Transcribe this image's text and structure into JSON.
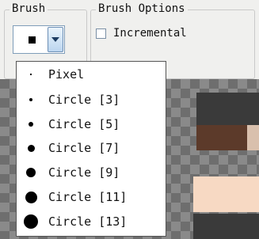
{
  "brush_group": {
    "title": "Brush",
    "selected_icon": "square-brush-icon"
  },
  "options_group": {
    "title": "Brush Options",
    "incremental_label": "Incremental",
    "incremental_checked": false
  },
  "dropdown": {
    "items": [
      {
        "label": "Pixel",
        "icon": "pixel-brush-icon"
      },
      {
        "label": "Circle [3]",
        "icon": "circle-3-icon"
      },
      {
        "label": "Circle [5]",
        "icon": "circle-5-icon"
      },
      {
        "label": "Circle [7]",
        "icon": "circle-7-icon"
      },
      {
        "label": "Circle [9]",
        "icon": "circle-9-icon"
      },
      {
        "label": "Circle [11]",
        "icon": "circle-11-icon"
      },
      {
        "label": "Circle [13]",
        "icon": "circle-13-icon"
      }
    ]
  },
  "colors": {
    "accent": "#7f9db9",
    "canvas_dark": "#6e6e6e",
    "canvas_light": "#8a8a8a",
    "skin": "#f7d9c3"
  }
}
